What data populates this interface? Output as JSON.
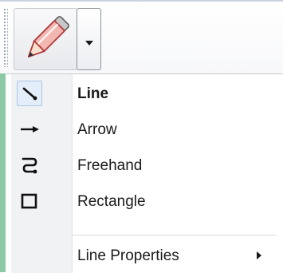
{
  "toolbar": {
    "tool_button_icon": "pencil-icon",
    "dropdown_icon": "dropdown-arrow-icon"
  },
  "menu": {
    "items": [
      {
        "label": "Line",
        "icon": "line-tool-icon",
        "checked": true
      },
      {
        "label": "Arrow",
        "icon": "arrow-tool-icon",
        "checked": false
      },
      {
        "label": "Freehand",
        "icon": "freehand-tool-icon",
        "checked": false
      },
      {
        "label": "Rectangle",
        "icon": "rectangle-tool-icon",
        "checked": false
      }
    ],
    "properties": {
      "label": "Line Properties",
      "icon": "submenu-arrow-icon"
    }
  },
  "colors": {
    "accent_strip": "#8cc9a7",
    "checked_bg": "#e4eefa",
    "pencil_body": "#f3b7b2"
  }
}
